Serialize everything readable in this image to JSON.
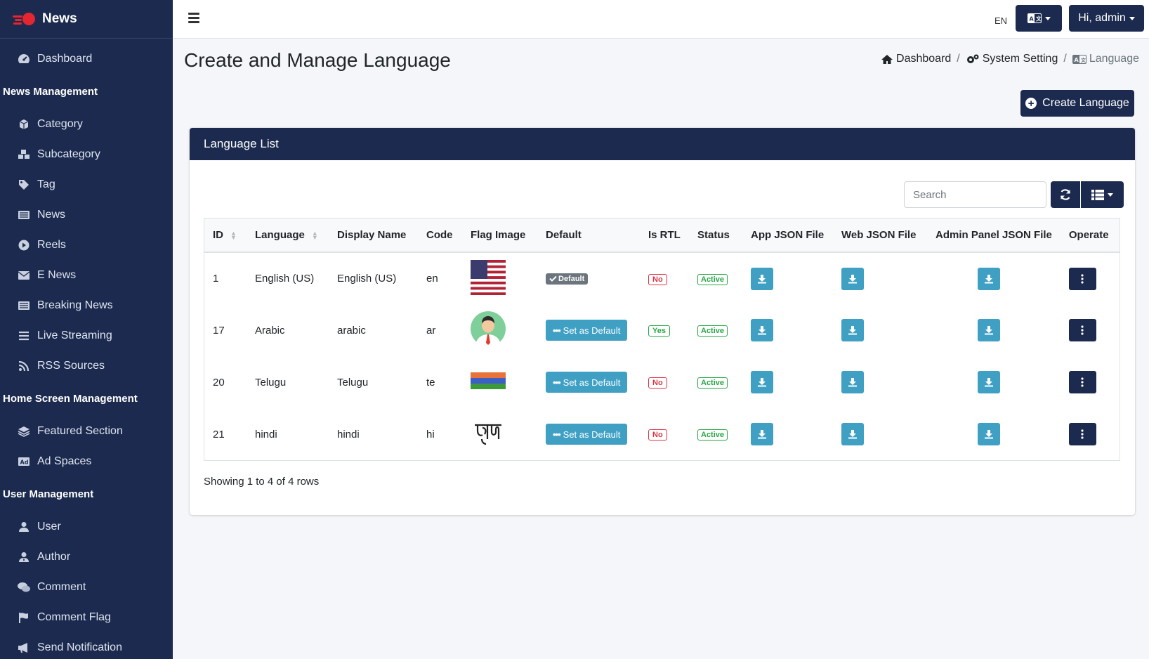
{
  "brand": {
    "name": "News"
  },
  "sidebar": {
    "dashboard": "Dashboard",
    "sections": [
      {
        "header": "News Management",
        "items": [
          {
            "label": "Category",
            "icon": "cube-icon"
          },
          {
            "label": "Subcategory",
            "icon": "cubes-icon"
          },
          {
            "label": "Tag",
            "icon": "tag-icon"
          },
          {
            "label": "News",
            "icon": "newspaper-icon"
          },
          {
            "label": "Reels",
            "icon": "play-circle-icon"
          },
          {
            "label": "E News",
            "icon": "envelope-icon"
          },
          {
            "label": "Breaking News",
            "icon": "newspaper-icon"
          },
          {
            "label": "Live Streaming",
            "icon": "list-icon"
          },
          {
            "label": "RSS Sources",
            "icon": "rss-icon"
          }
        ]
      },
      {
        "header": "Home Screen Management",
        "items": [
          {
            "label": "Featured Section",
            "icon": "layers-icon"
          },
          {
            "label": "Ad Spaces",
            "icon": "ad-icon"
          }
        ]
      },
      {
        "header": "User Management",
        "items": [
          {
            "label": "User",
            "icon": "user-icon"
          },
          {
            "label": "Author",
            "icon": "user-tie-icon"
          },
          {
            "label": "Comment",
            "icon": "comments-icon"
          },
          {
            "label": "Comment Flag",
            "icon": "flag-icon"
          },
          {
            "label": "Send Notification",
            "icon": "bullhorn-icon"
          }
        ]
      }
    ]
  },
  "topbar": {
    "lang_code": "EN",
    "user_label": "Hi, admin"
  },
  "page": {
    "title": "Create and Manage Language",
    "breadcrumb": [
      "Dashboard",
      "System Setting",
      "Language"
    ],
    "create_label": "Create Language"
  },
  "card": {
    "title": "Language List",
    "search_placeholder": "Search",
    "footer": "Showing 1 to 4 of 4 rows"
  },
  "table": {
    "headers": {
      "id": "ID",
      "language": "Language",
      "display_name": "Display Name",
      "code": "Code",
      "flag": "Flag Image",
      "default": "Default",
      "rtl": "Is RTL",
      "status": "Status",
      "app": "App JSON File",
      "web": "Web JSON File",
      "admin": "Admin Panel JSON File",
      "operate": "Operate"
    },
    "rows": [
      {
        "id": "1",
        "language": "English (US)",
        "display_name": "English (US)",
        "code": "en",
        "flag": "us-flag-icon",
        "default": "Default",
        "rtl": "No",
        "status": "Active"
      },
      {
        "id": "17",
        "language": "Arabic",
        "display_name": "arabic",
        "code": "ar",
        "flag": "avatar-icon",
        "default": "Set as Default",
        "rtl": "Yes",
        "status": "Active"
      },
      {
        "id": "20",
        "language": "Telugu",
        "display_name": "Telugu",
        "code": "te",
        "flag": "tricolor-flag-icon",
        "default": "Set as Default",
        "rtl": "No",
        "status": "Active"
      },
      {
        "id": "21",
        "language": "hindi",
        "display_name": "hindi",
        "code": "hi",
        "flag": "hindi-text-icon",
        "default": "Set as Default",
        "rtl": "No",
        "status": "Active"
      }
    ]
  },
  "colors": {
    "primary": "#1b2a4e",
    "info": "#3fa0c4",
    "danger": "#dc3545",
    "success": "#28a745",
    "brand_red": "#e3262f"
  }
}
